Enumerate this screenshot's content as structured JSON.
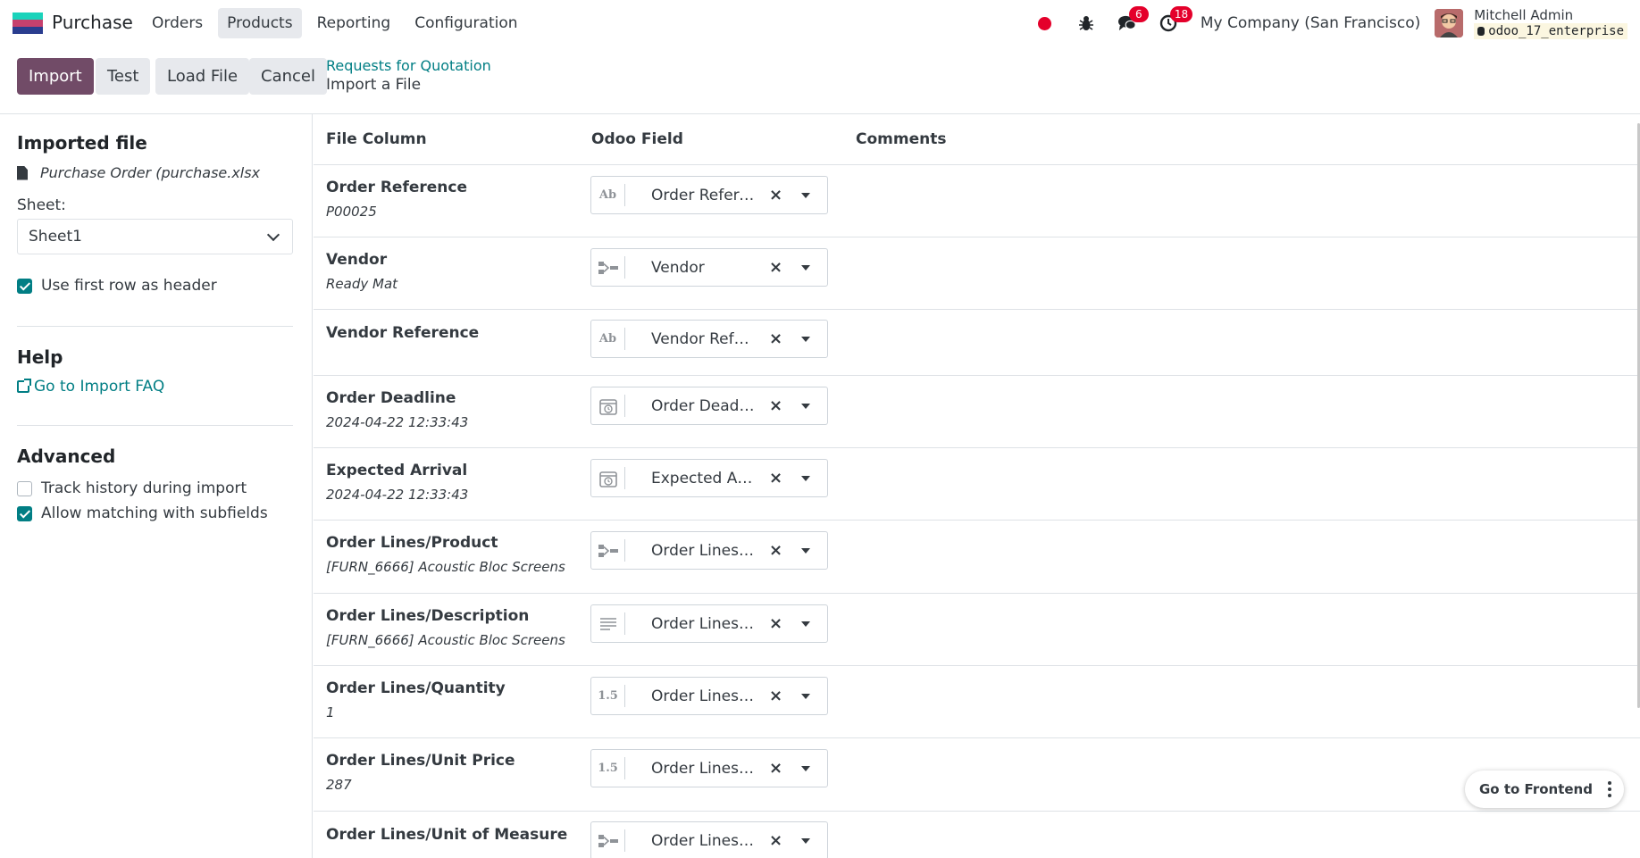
{
  "navbar": {
    "app_name": "Purchase",
    "menu": [
      "Orders",
      "Products",
      "Reporting",
      "Configuration"
    ],
    "active_menu": "Products",
    "messages_count": "6",
    "activities_count": "18",
    "company": "My Company (San Francisco)",
    "user_name": "Mitchell Admin",
    "db_name": "odoo_17_enterprise",
    "logo_colors": [
      "#1ad3bb",
      "#c6416e",
      "#2a3d8f"
    ],
    "badge_color": "#e4002b"
  },
  "control": {
    "import_label": "Import",
    "test_label": "Test",
    "load_file_label": "Load File",
    "cancel_label": "Cancel",
    "breadcrumb_parent": "Requests for Quotation",
    "breadcrumb_current": "Import a File"
  },
  "sidebar": {
    "imported_file_title": "Imported file",
    "file_name": "Purchase Order (purchase.xlsx",
    "sheet_label": "Sheet:",
    "sheet_value": "Sheet1",
    "use_header_label": "Use first row as header",
    "use_header_checked": true,
    "help_title": "Help",
    "faq_label": "Go to Import FAQ",
    "advanced_title": "Advanced",
    "track_history_label": "Track history during import",
    "track_history_checked": false,
    "subfields_label": "Allow matching with subfields",
    "subfields_checked": true
  },
  "table": {
    "headers": {
      "file_column": "File Column",
      "odoo_field": "Odoo Field",
      "comments": "Comments"
    },
    "rows": [
      {
        "name": "Order Reference",
        "sample": "P00025",
        "type_icon": "Ab",
        "field": "Order Reference"
      },
      {
        "name": "Vendor",
        "sample": "Ready Mat",
        "type_icon": "relation",
        "field": "Vendor"
      },
      {
        "name": "Vendor Reference",
        "sample": "",
        "type_icon": "Ab",
        "field": "Vendor Reference"
      },
      {
        "name": "Order Deadline",
        "sample": "2024-04-22 12:33:43",
        "type_icon": "calendar",
        "field": "Order Deadline"
      },
      {
        "name": "Expected Arrival",
        "sample": "2024-04-22 12:33:43",
        "type_icon": "calendar",
        "field": "Expected Arrival"
      },
      {
        "name": "Order Lines/Product",
        "sample": "[FURN_6666] Acoustic Bloc Screens",
        "type_icon": "relation",
        "field": "Order Lines / Product"
      },
      {
        "name": "Order Lines/Description",
        "sample": "[FURN_6666] Acoustic Bloc Screens",
        "type_icon": "text",
        "field": "Order Lines / Description"
      },
      {
        "name": "Order Lines/Quantity",
        "sample": "1",
        "type_icon": "1.5",
        "field": "Order Lines / Quantity"
      },
      {
        "name": "Order Lines/Unit Price",
        "sample": "287",
        "type_icon": "1.5",
        "field": "Order Lines / Unit Price"
      },
      {
        "name": "Order Lines/Unit of Measure",
        "sample": "",
        "type_icon": "relation",
        "field": "Order Lines / Unit of Measure"
      }
    ]
  },
  "floating": {
    "frontend_label": "Go to Frontend"
  }
}
